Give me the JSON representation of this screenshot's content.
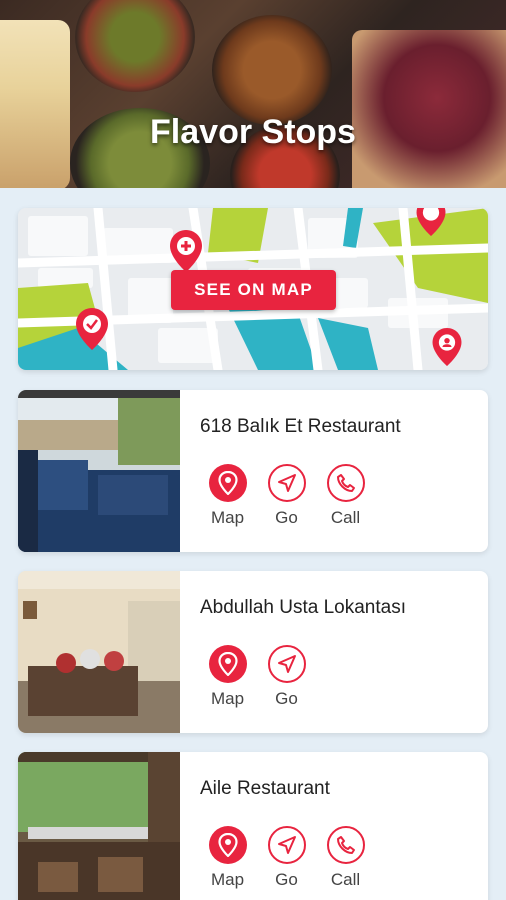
{
  "header": {
    "title": "Flavor Stops"
  },
  "map_card": {
    "button_label": "SEE ON MAP"
  },
  "restaurants": [
    {
      "name": "618 Balık Et Restaurant",
      "actions": [
        "Map",
        "Go",
        "Call"
      ]
    },
    {
      "name": "Abdullah Usta Lokantası",
      "actions": [
        "Map",
        "Go"
      ]
    },
    {
      "name": "Aile Restaurant",
      "actions": [
        "Map",
        "Go",
        "Call"
      ]
    }
  ],
  "icons": {
    "map": "map-pin-icon",
    "go": "navigation-arrow-icon",
    "call": "phone-icon"
  },
  "colors": {
    "accent": "#e8243f",
    "background": "#e4eef6"
  }
}
